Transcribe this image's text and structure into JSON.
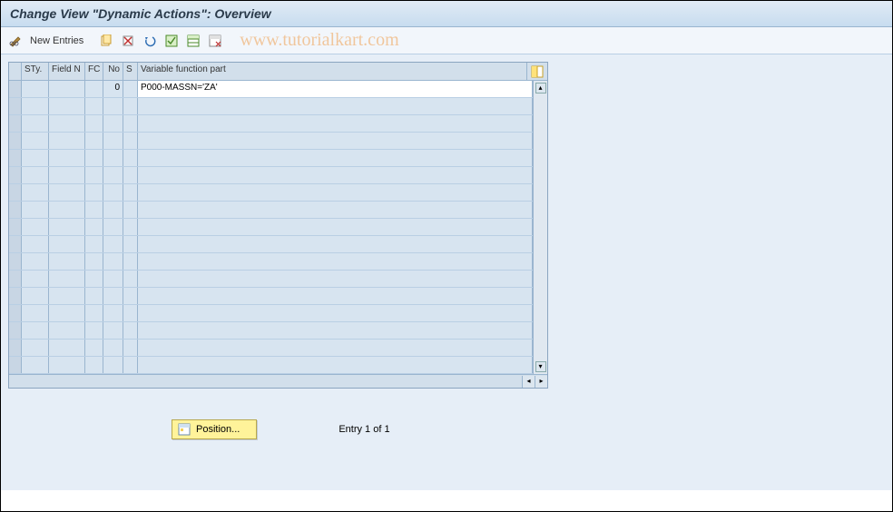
{
  "title": "Change View \"Dynamic Actions\": Overview",
  "watermark": "www.tutorialkart.com",
  "toolbar": {
    "new_entries_label": "New Entries"
  },
  "grid": {
    "columns": {
      "sty": "STy.",
      "field_n": "Field N",
      "fc": "FC",
      "no": "No",
      "s": "S",
      "var_func": "Variable function part"
    },
    "rows": [
      {
        "sty": "",
        "field_n": "",
        "fc": "",
        "no": "0",
        "s": "",
        "var_func": "P000-MASSN='ZA'"
      }
    ],
    "empty_row_count": 16
  },
  "footer": {
    "position_label": "Position...",
    "entry_text": "Entry 1 of 1"
  }
}
